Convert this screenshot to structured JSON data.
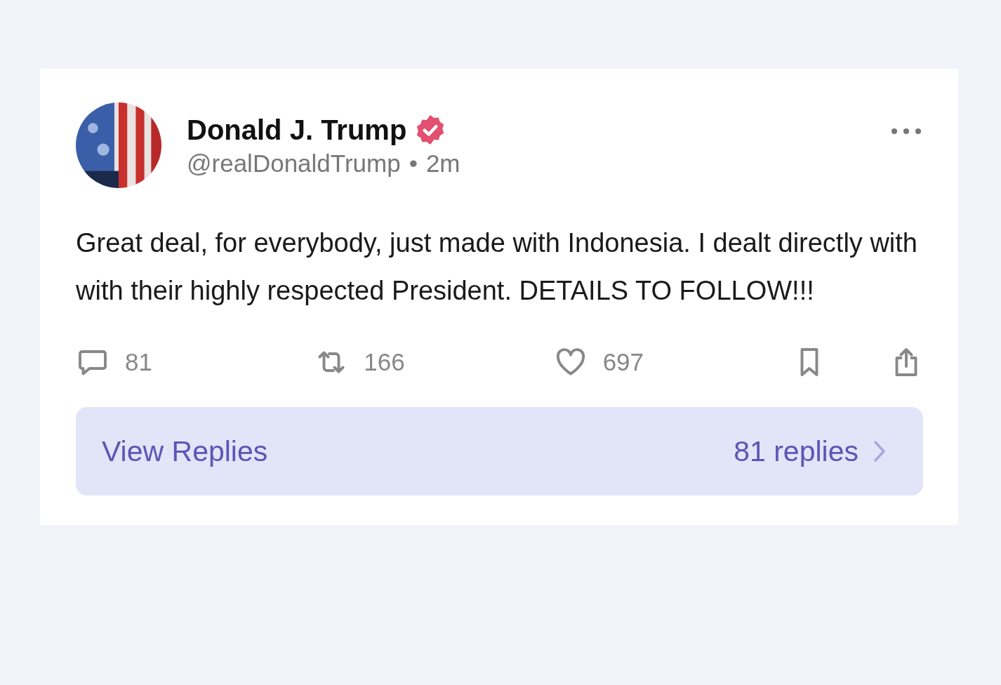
{
  "post": {
    "author": "Donald J. Trump",
    "verified": true,
    "handle": "@realDonaldTrump",
    "separator": "•",
    "time": "2m",
    "text": "Great deal, for everybody, just made with Indonesia. I dealt directly with with their highly respected President. DETAILS TO FOLLOW!!!",
    "stats": [
      {
        "kind": "reply",
        "count": "81"
      },
      {
        "kind": "repost",
        "count": "166"
      },
      {
        "kind": "like",
        "count": "697"
      }
    ],
    "view_replies": {
      "label": "View Replies",
      "count": "81 replies"
    }
  }
}
